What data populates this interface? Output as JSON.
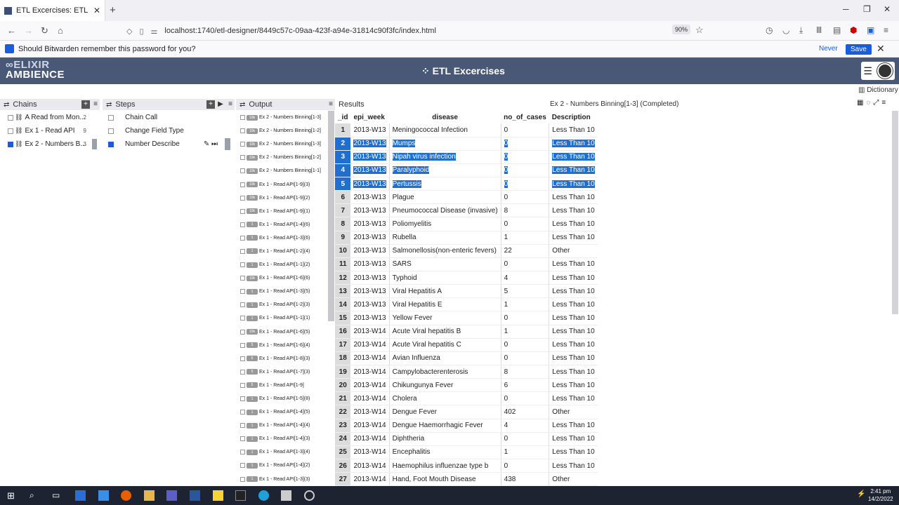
{
  "browser": {
    "tab_title": "ETL Excercises: ETL",
    "url": "localhost:1740/etl-designer/8449c57c-09aa-423f-a94e-31814c90f3fc/index.html",
    "zoom": "90%",
    "notification": {
      "message": "Should Bitwarden remember this password for you?",
      "never": "Never",
      "save": "Save"
    }
  },
  "app": {
    "logo_line1": "ELIXIR",
    "logo_line2": "AMBIENCE",
    "title": "ETL Excercises",
    "dictionary": "Dictionary"
  },
  "panels": {
    "chains": "Chains",
    "steps": "Steps",
    "output": "Output",
    "results": "Results"
  },
  "chains": [
    {
      "label": "A Read from Mon...",
      "count": "2",
      "checked": false
    },
    {
      "label": "Ex 1 - Read API",
      "count": "9",
      "checked": false
    },
    {
      "label": "Ex 2 - Numbers B...",
      "count": "3",
      "checked": true
    }
  ],
  "steps": [
    {
      "label": "Chain Call",
      "checked": false
    },
    {
      "label": "Change Field Type",
      "checked": false
    },
    {
      "label": "Number Describe",
      "checked": true
    }
  ],
  "outputs": [
    {
      "badge": "10k",
      "label": "Ex 2 - Numbers Binning[1-3]"
    },
    {
      "badge": "10k",
      "label": "Ex 2 - Numbers Binning[1-2]"
    },
    {
      "badge": "10k",
      "label": "Ex 2 - Numbers Binning[1-3]"
    },
    {
      "badge": "10k",
      "label": "Ex 2 - Numbers Binning[1-2]"
    },
    {
      "badge": "10k",
      "label": "Ex 2 - Numbers Binning[1-1]"
    },
    {
      "badge": "10k",
      "label": "Ex 1 - Read API[1-9](3)"
    },
    {
      "badge": "10k",
      "label": "Ex 1 - Read API[1-9](2)"
    },
    {
      "badge": "10k",
      "label": "Ex 1 - Read API[1-9](1)"
    },
    {
      "badge": "1",
      "label": "Ex 1 - Read API[1-4](6)"
    },
    {
      "badge": "1",
      "label": "Ex 1 - Read API[1-3](6)"
    },
    {
      "badge": "1",
      "label": "Ex 1 - Read API[1-2](4)"
    },
    {
      "badge": "1",
      "label": "Ex 1 - Read API[1-1](2)"
    },
    {
      "badge": "10k",
      "label": "Ex 1 - Read API[1-6](6)"
    },
    {
      "badge": "1",
      "label": "Ex 1 - Read API[1-3](5)"
    },
    {
      "badge": "1",
      "label": "Ex 1 - Read API[1-2](3)"
    },
    {
      "badge": "1",
      "label": "Ex 1 - Read API[1-1](1)"
    },
    {
      "badge": "10k",
      "label": "Ex 1 - Read API[1-6](5)"
    },
    {
      "badge": "5",
      "label": "Ex 1 - Read API[1-6](4)"
    },
    {
      "badge": "5",
      "label": "Ex 1 - Read API[1-8](3)"
    },
    {
      "badge": "5",
      "label": "Ex 1 - Read API[1-7](3)"
    },
    {
      "badge": "5",
      "label": "Ex 1 - Read API[1-9]"
    },
    {
      "badge": "1",
      "label": "Ex 1 - Read API[1-5](8)"
    },
    {
      "badge": "1",
      "label": "Ex 1 - Read API[1-4](5)"
    },
    {
      "badge": "1",
      "label": "Ex 1 - Read API[1-4](4)"
    },
    {
      "badge": "1",
      "label": "Ex 1 - Read API[1-4](3)"
    },
    {
      "badge": "1",
      "label": "Ex 1 - Read API[1-3](4)"
    },
    {
      "badge": "1",
      "label": "Ex 1 - Read API[1-4](2)"
    },
    {
      "badge": "1",
      "label": "Ex 1 - Read API[1-3](3)"
    }
  ],
  "results": {
    "title": "Ex 2 - Numbers Binning[1-3] (Completed)",
    "columns": [
      "_id",
      "epi_week",
      "disease",
      "no_of_cases",
      "Description"
    ],
    "rows": [
      [
        "1",
        "2013-W13",
        "Meningococcal Infection",
        "0",
        "Less Than 10"
      ],
      [
        "2",
        "2013-W13",
        "Mumps",
        "0",
        "Less Than 10"
      ],
      [
        "3",
        "2013-W13",
        "Nipah virus infection",
        "0",
        "Less Than 10"
      ],
      [
        "4",
        "2013-W13",
        "Paralyphoid",
        "0",
        "Less Than 10"
      ],
      [
        "5",
        "2013-W13",
        "Pertussis",
        "0",
        "Less Than 10"
      ],
      [
        "6",
        "2013-W13",
        "Plague",
        "0",
        "Less Than 10"
      ],
      [
        "7",
        "2013-W13",
        "Pneumococcal Disease (invasive)",
        "8",
        "Less Than 10"
      ],
      [
        "8",
        "2013-W13",
        "Poliomyelitis",
        "0",
        "Less Than 10"
      ],
      [
        "9",
        "2013-W13",
        "Rubella",
        "1",
        "Less Than 10"
      ],
      [
        "10",
        "2013-W13",
        "Salmonellosis(non-enteric fevers)",
        "22",
        "Other"
      ],
      [
        "11",
        "2013-W13",
        "SARS",
        "0",
        "Less Than 10"
      ],
      [
        "12",
        "2013-W13",
        "Typhoid",
        "4",
        "Less Than 10"
      ],
      [
        "13",
        "2013-W13",
        "Viral Hepatitis A",
        "5",
        "Less Than 10"
      ],
      [
        "14",
        "2013-W13",
        "Viral Hepatitis E",
        "1",
        "Less Than 10"
      ],
      [
        "15",
        "2013-W13",
        "Yellow Fever",
        "0",
        "Less Than 10"
      ],
      [
        "16",
        "2013-W14",
        "Acute Viral hepatitis B",
        "1",
        "Less Than 10"
      ],
      [
        "17",
        "2013-W14",
        "Acute Viral hepatitis C",
        "0",
        "Less Than 10"
      ],
      [
        "18",
        "2013-W14",
        "Avian Influenza",
        "0",
        "Less Than 10"
      ],
      [
        "19",
        "2013-W14",
        "Campylobacterenterosis",
        "8",
        "Less Than 10"
      ],
      [
        "20",
        "2013-W14",
        "Chikungunya Fever",
        "6",
        "Less Than 10"
      ],
      [
        "21",
        "2013-W14",
        "Cholera",
        "0",
        "Less Than 10"
      ],
      [
        "22",
        "2013-W14",
        "Dengue Fever",
        "402",
        "Other"
      ],
      [
        "23",
        "2013-W14",
        "Dengue Haemorrhagic Fever",
        "4",
        "Less Than 10"
      ],
      [
        "24",
        "2013-W14",
        "Diphtheria",
        "0",
        "Less Than 10"
      ],
      [
        "25",
        "2013-W14",
        "Encephalitis",
        "1",
        "Less Than 10"
      ],
      [
        "26",
        "2013-W14",
        "Haemophilus influenzae type b",
        "0",
        "Less Than 10"
      ],
      [
        "27",
        "2013-W14",
        "Hand, Foot Mouth Disease",
        "438",
        "Other"
      ]
    ],
    "selected_rows": [
      2,
      3,
      4,
      5
    ]
  },
  "taskbar": {
    "time": "2:41 pm",
    "date": "14/2/2022"
  },
  "colors": {
    "header": "#4a5878",
    "selection": "#1f6fd0",
    "bitwarden": "#175ddc"
  }
}
